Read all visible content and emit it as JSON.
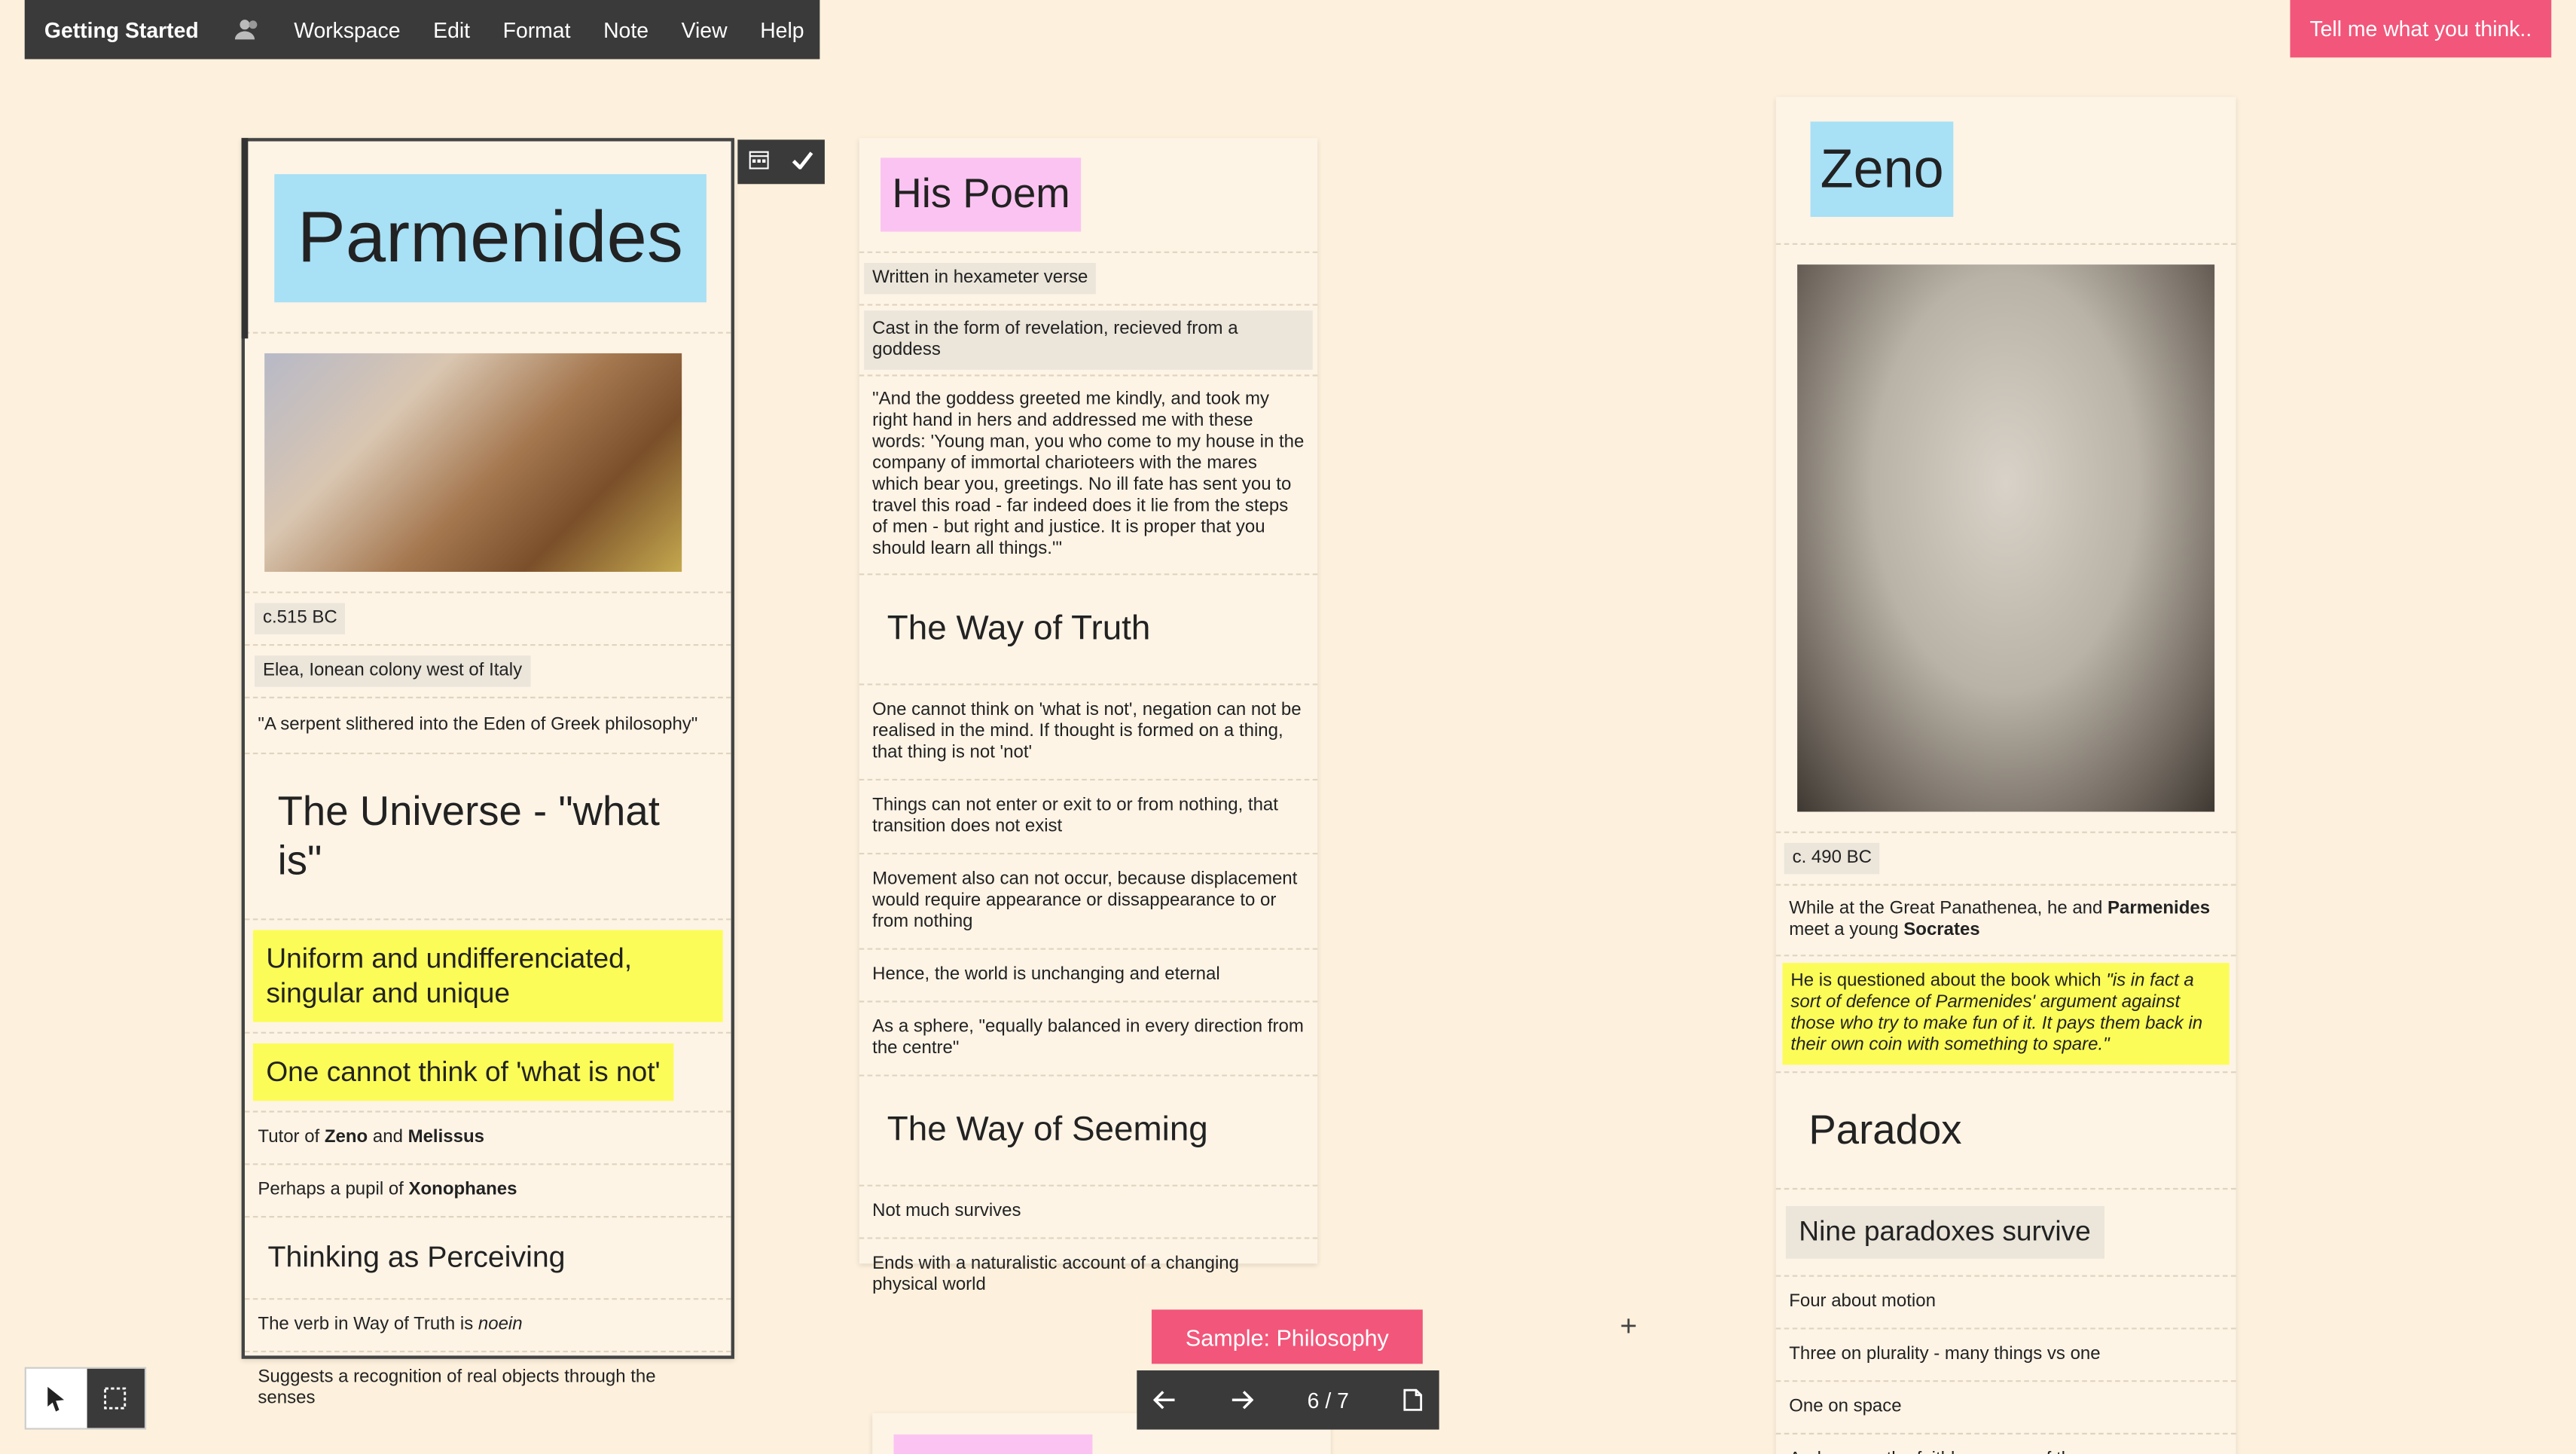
{
  "menu": {
    "app_title": "Getting Started",
    "items": [
      "Workspace",
      "Edit",
      "Format",
      "Note",
      "View",
      "Help"
    ]
  },
  "feedback_label": "Tell me what you think..",
  "col1": {
    "title": "Parmenides",
    "date": "c.515 BC",
    "place": "Elea, Ionean colony west of Italy",
    "quote": "\"A serpent slithered into the Eden of Greek philosophy\"",
    "heading1": "The Universe - \"what is\"",
    "y1": "Uniform and undifferenciated, singular and unique",
    "y2": "One cannot think of 'what is not'",
    "tutor_prefix": "Tutor of ",
    "tutor_a": "Zeno",
    "tutor_mid": " and ",
    "tutor_b": "Melissus",
    "pupil_prefix": "Perhaps a pupil of ",
    "pupil_name": "Xonophanes",
    "heading2": "Thinking as Perceiving",
    "verb_prefix": "The verb in Way of Truth is ",
    "verb_word": "noein",
    "suggests": "Suggests a recognition of real objects through the senses"
  },
  "col2": {
    "title": "His Poem",
    "r1": "Written in hexameter verse",
    "r2": "Cast in the form of revelation, recieved from a goddess",
    "r3": "\"And the goddess greeted me kindly, and took my right hand in hers and addressed me with these words: 'Young man, you who come to my house in the company of immortal charioteers with the mares which bear you, greetings. No ill fate has sent you to travel this road - far indeed does it lie from the steps of men - but right and justice. It is proper that you should learn all things.'\"",
    "h1": "The Way of Truth",
    "r4": "One cannot think on 'what is not', negation can not be realised in the mind. If thought is formed on a thing, that thing is not 'not'",
    "r5": "Things can not enter or exit to or from nothing, that transition does not exist",
    "r6": "Movement also can not occur, because displacement would require appearance or dissappearance to or from nothing",
    "r7": "Hence, the world is unchanging and eternal",
    "r8": "As a sphere, \"equally balanced in every direction from the centre\"",
    "h2": "The Way of Seeming",
    "r9": "Not much survives",
    "r10": "Ends with a naturalistic account of a changing physical world"
  },
  "col3": {
    "title": "Zeno",
    "date": "c. 490 BC",
    "r1_prefix": "While at the Great Panathenea, he and ",
    "r1_a": "Parmenides",
    "r1_mid": " meet a young ",
    "r1_b": "Socrates",
    "y_prefix": "He is questioned about the book which ",
    "y_quote": "\"is in fact a sort of defence of Parmenides' argument against those who try to make fun of it. It pays them back in their own coin with something to spare.\"",
    "h1": "Paradox",
    "chip": "Nine paradoxes survive",
    "r2": "Four about motion",
    "r3": "Three on plurality - many things vs one",
    "r4": "One on space",
    "r5": "And one on the faithlesseness of the senses"
  },
  "sample_label": "Sample: Philosophy",
  "pager": {
    "count": "6 / 7"
  }
}
